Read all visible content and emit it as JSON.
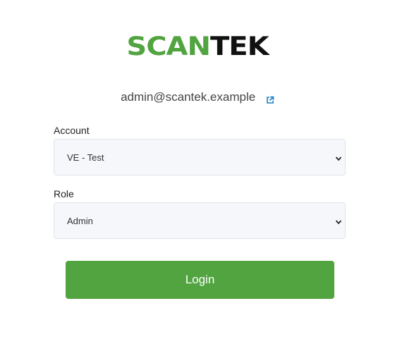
{
  "logo": {
    "part1": "SCAN",
    "part2": "TEK",
    "colors": {
      "part1": "#52a441",
      "part2": "#111111"
    }
  },
  "user": {
    "email": "admin@scantek.example",
    "link_icon": "external-link-icon"
  },
  "account": {
    "label": "Account",
    "selected": "VE - Test",
    "icon": "chevron-down-icon"
  },
  "role": {
    "label": "Role",
    "selected": "Admin",
    "icon": "chevron-down-icon"
  },
  "login": {
    "label": "Login",
    "color": "#52a441"
  }
}
